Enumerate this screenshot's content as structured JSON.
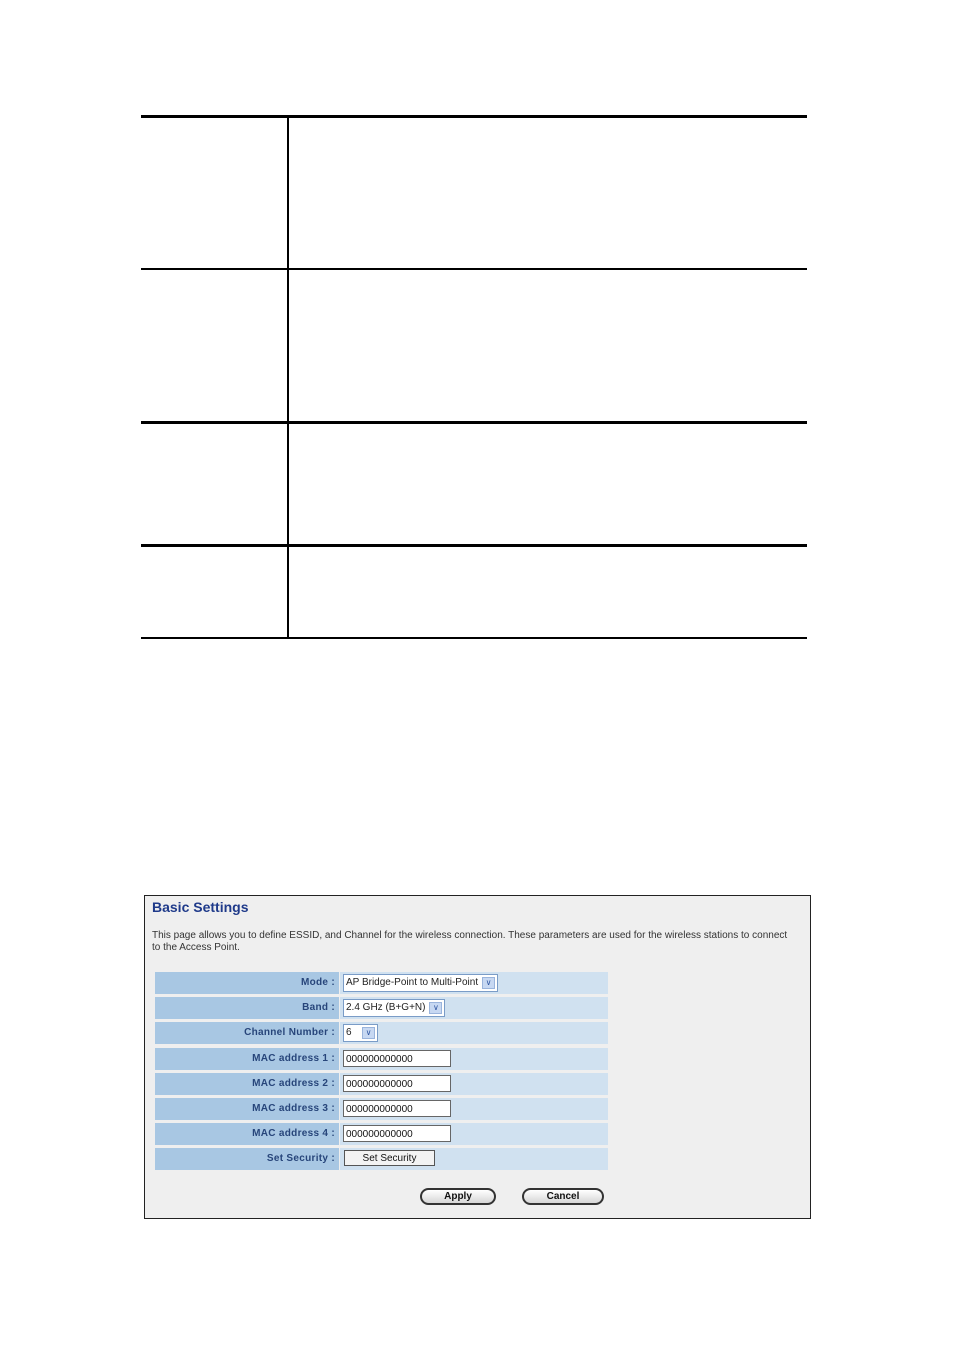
{
  "settings": {
    "title": "Basic Settings",
    "description": "This page allows you to define ESSID, and Channel for the wireless connection. These parameters are used for the wireless stations to connect to the Access Point.",
    "fields": [
      {
        "label": "Mode :",
        "type": "select",
        "value": "AP Bridge-Point to Multi-Point"
      },
      {
        "label": "Band :",
        "type": "select",
        "value": "2.4 GHz (B+G+N)"
      },
      {
        "label": "Channel Number :",
        "type": "select",
        "value": "6"
      },
      {
        "label": "MAC address 1 :",
        "type": "input",
        "value": "000000000000"
      },
      {
        "label": "MAC address 2 :",
        "type": "input",
        "value": "000000000000"
      },
      {
        "label": "MAC address 3 :",
        "type": "input",
        "value": "000000000000"
      },
      {
        "label": "MAC address 4 :",
        "type": "input",
        "value": "000000000000"
      },
      {
        "label": "Set Security :",
        "type": "button",
        "value": "Set Security"
      }
    ],
    "apply_label": "Apply",
    "cancel_label": "Cancel",
    "dropdown_icon": "chevron-down-icon"
  },
  "colors": {
    "title": "#1f3a8a",
    "label_bg": "#a8c7e3",
    "value_bg": "#d0e1f0",
    "panel_bg": "#efefef"
  }
}
